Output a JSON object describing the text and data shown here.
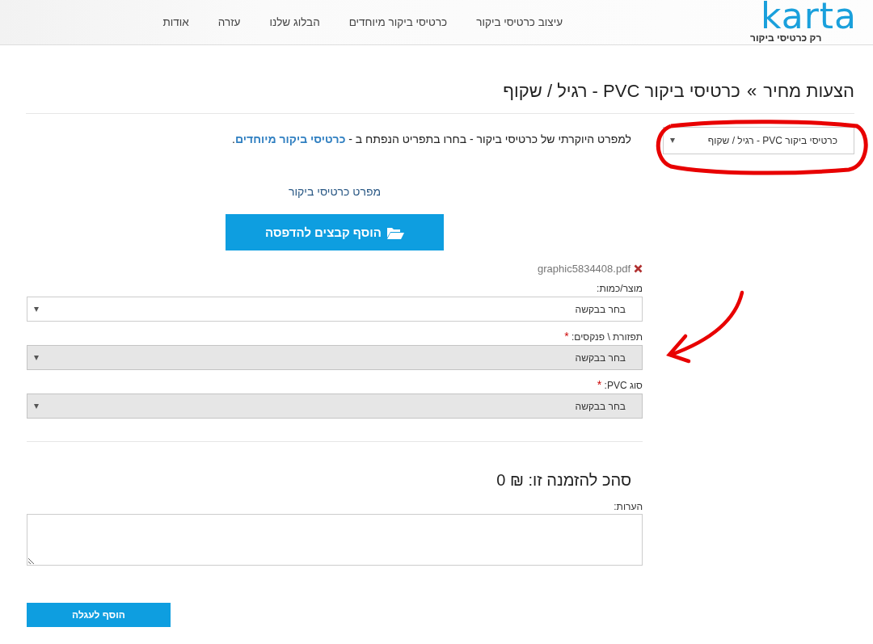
{
  "header": {
    "logo": {
      "wordmark": "karta",
      "tagline": "רק כרטיסי ביקור"
    },
    "nav": [
      {
        "label": "עיצוב כרטיסי ביקור"
      },
      {
        "label": "כרטיסי ביקור מיוחדים"
      },
      {
        "label": "הבלוג שלנו"
      },
      {
        "label": "עזרה"
      },
      {
        "label": "אודות"
      }
    ]
  },
  "breadcrumb": {
    "parent": "הצעות מחיר",
    "separator": "»",
    "current": "כרטיסי ביקור PVC - רגיל / שקוף"
  },
  "product_select": {
    "value": "כרטיסי ביקור PVC - רגיל / שקוף"
  },
  "intro": {
    "text": "למפרט היוקרתי של כרטיסי ביקור - בחרו בתפריט הנפתח ב - ",
    "link": "כרטיסי ביקור מיוחדים",
    "end": "."
  },
  "spec_link": "מפרט כרטיסי ביקור",
  "upload_button": "הוסף קבצים להדפסה",
  "files": [
    {
      "name": "graphic5834408.pdf"
    }
  ],
  "fields": [
    {
      "label": "מוצר/כמות:",
      "value": "בחר בבקשה",
      "disabled": false
    },
    {
      "label": "תפזורת \\ פנקסים:",
      "required_mark": "*",
      "value": "בחר בבקשה",
      "disabled": true
    },
    {
      "label": "סוג PVC:",
      "required_mark": "*",
      "value": "בחר בבקשה",
      "disabled": true
    }
  ],
  "total": "סהכ להזמנה זו: ₪ 0",
  "notes": {
    "label": "הערות:"
  },
  "submit_button": "הוסף לעגלה"
}
